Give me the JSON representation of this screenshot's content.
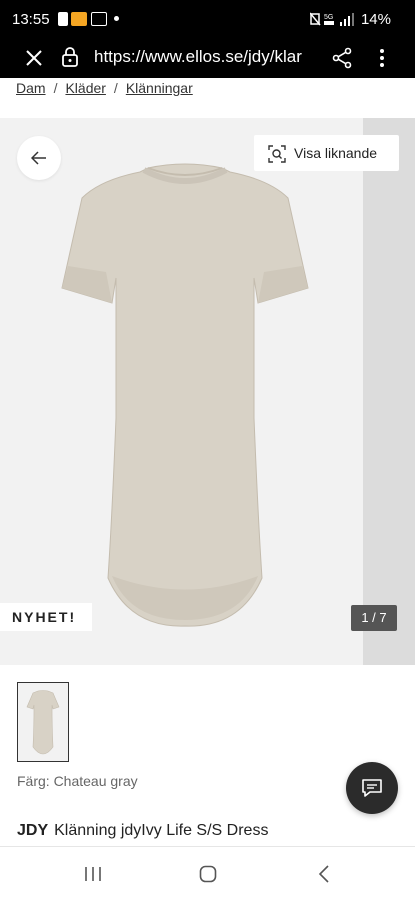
{
  "status_bar": {
    "time": "13:55",
    "battery": "14%",
    "network": "5G"
  },
  "browser": {
    "url": "https://www.ellos.se/jdy/klar"
  },
  "breadcrumb": [
    "Dam",
    "Kläder",
    "Klänningar"
  ],
  "gallery": {
    "similar_label": "Visa liknande",
    "new_badge": "NYHET!",
    "counter": "1 / 7"
  },
  "product": {
    "color_label": "Färg: Chateau gray",
    "brand": "JDY",
    "title": "Klänning jdyIvy Life S/S Dress"
  },
  "colors": {
    "dress": "#d8d2c6",
    "gallery_bg": "#f2f2f2"
  },
  "icons": {
    "close": "close-icon",
    "lock": "lock-icon",
    "share": "share-icon",
    "menu": "more-vert-icon",
    "back": "arrow-left-icon",
    "similar": "visual-search-icon",
    "chat": "chat-icon"
  }
}
